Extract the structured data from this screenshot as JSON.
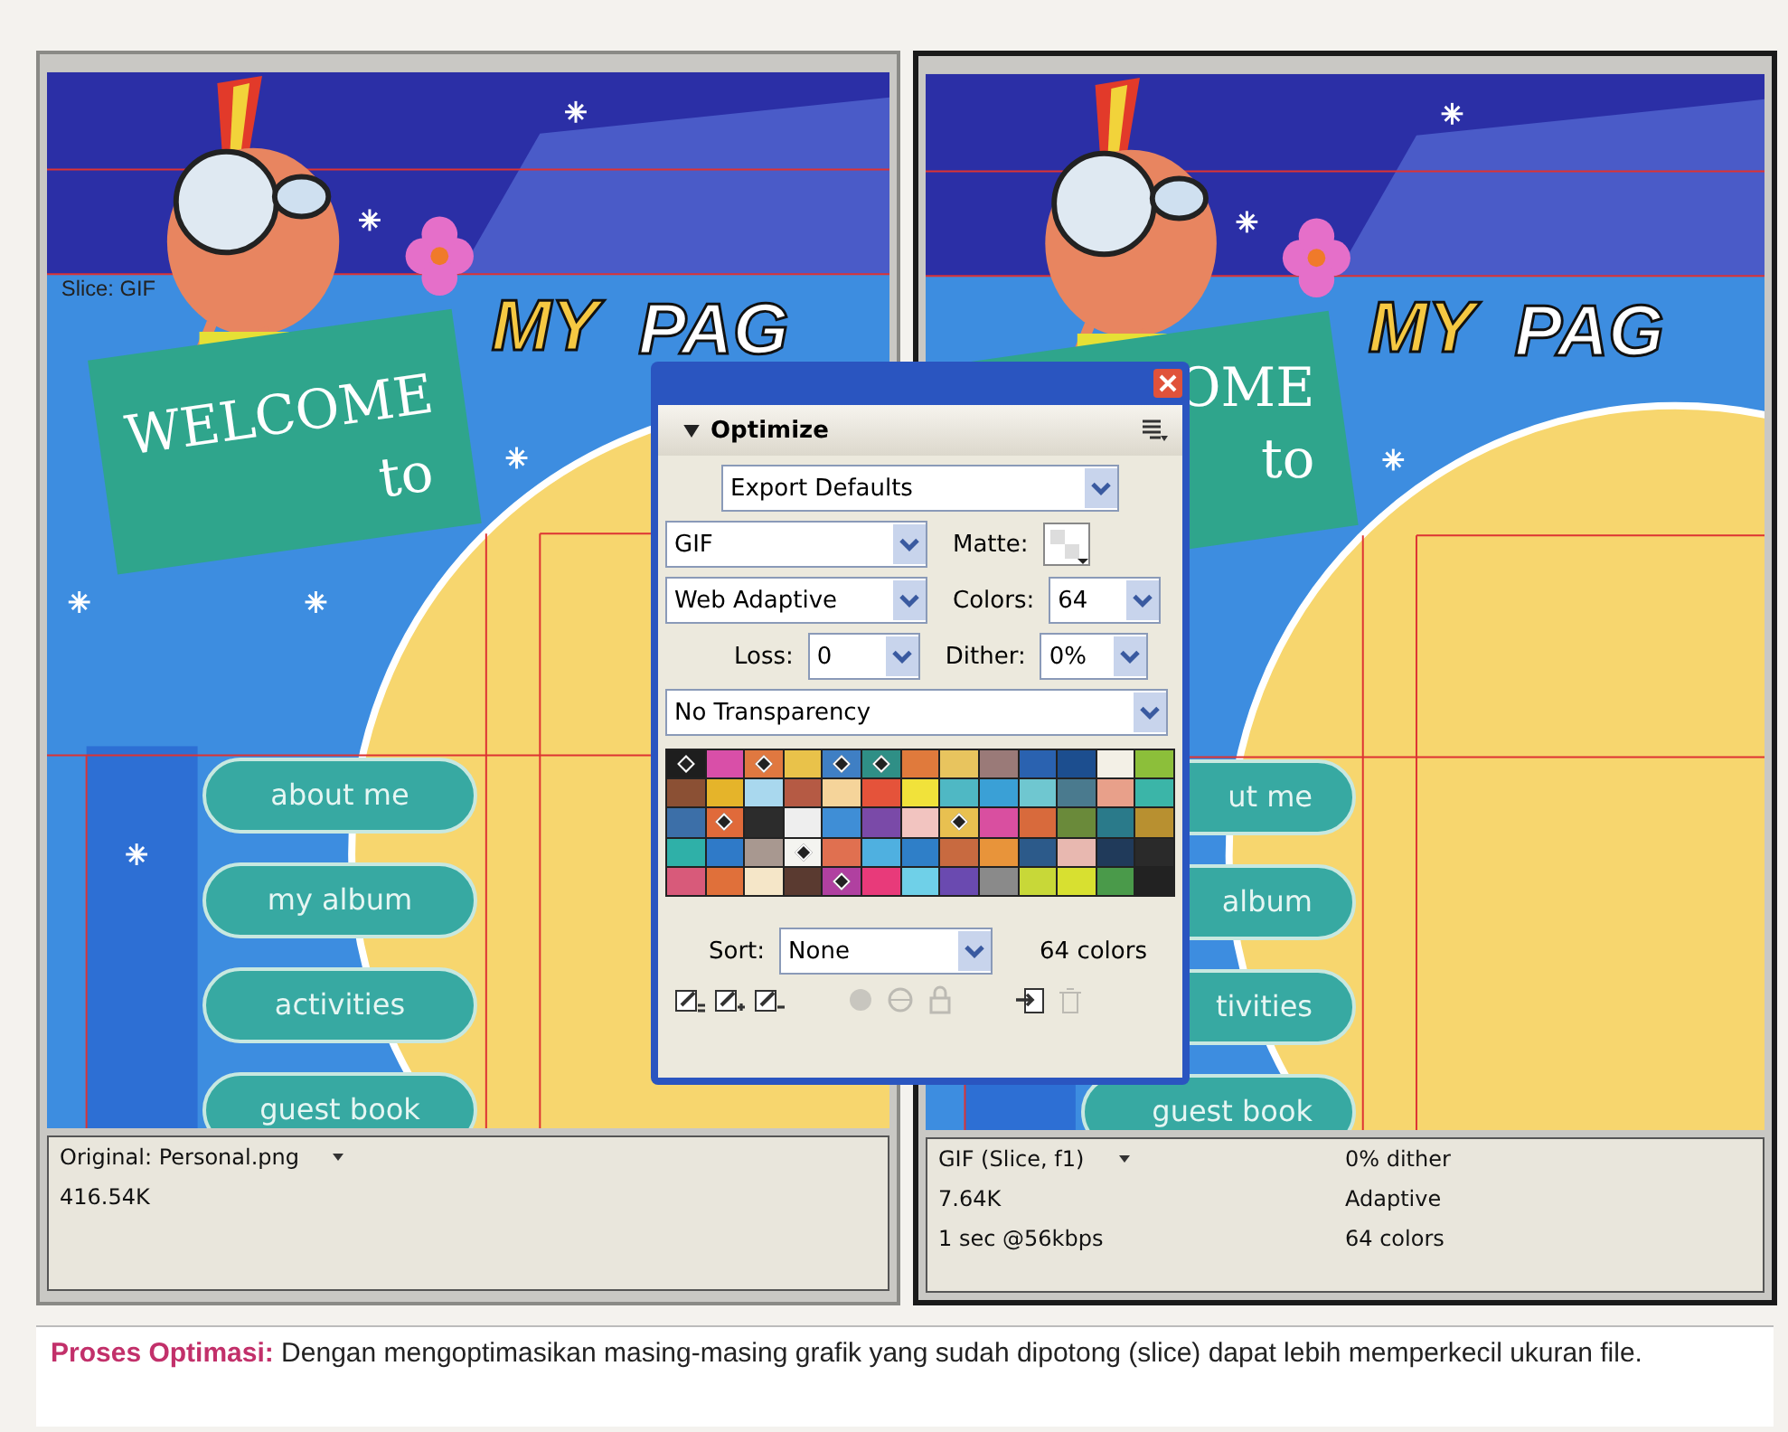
{
  "preview_panes": [
    {
      "selected": false,
      "canvas": {
        "slice_label": "Slice: GIF",
        "sign": [
          "WELCOME",
          "to"
        ],
        "title": [
          "MY",
          "PAG"
        ],
        "nav_buttons": [
          "about me",
          "my album",
          "activities",
          "guest book"
        ]
      },
      "info": {
        "format": "Original: Personal.png",
        "size": "416.54K"
      }
    },
    {
      "selected": true,
      "canvas": {
        "sign": [
          "OME",
          "to"
        ],
        "title": [
          "MY",
          "PAG"
        ],
        "nav_buttons": [
          "ut me",
          "album",
          "tivities",
          "guest book"
        ]
      },
      "info": {
        "format": "GIF (Slice, f1)",
        "size": "7.64K",
        "time": "1 sec @56kbps",
        "dither": "0% dither",
        "palette": "Adaptive",
        "colors": "64 colors"
      }
    }
  ],
  "optimize_panel": {
    "title": "Optimize",
    "preset": "Export Defaults",
    "format": "GIF",
    "matte_label": "Matte:",
    "palette": "Web Adaptive",
    "colors_label": "Colors:",
    "colors": "64",
    "loss_label": "Loss:",
    "loss": "0",
    "dither_label": "Dither:",
    "dither": "0%",
    "transparency": "No Transparency",
    "swatches": [
      {
        "color": "#1e1e1e",
        "marked": true
      },
      {
        "color": "#d94fa8",
        "marked": false
      },
      {
        "color": "#e07840",
        "marked": true
      },
      {
        "color": "#e9c24a",
        "marked": false
      },
      {
        "color": "#3f7fc4",
        "marked": true
      },
      {
        "color": "#2f8f86",
        "marked": true
      },
      {
        "color": "#e07a3c",
        "marked": false
      },
      {
        "color": "#e8c45e",
        "marked": false
      },
      {
        "color": "#9a7a78",
        "marked": false
      },
      {
        "color": "#2a62b0",
        "marked": false
      },
      {
        "color": "#1c4e8f",
        "marked": false
      },
      {
        "color": "#f3f0e6",
        "marked": false
      },
      {
        "color": "#8cbf3a",
        "marked": false
      },
      {
        "color": "#8b5034",
        "marked": false
      },
      {
        "color": "#e5b42a",
        "marked": false
      },
      {
        "color": "#a9d8ee",
        "marked": false
      },
      {
        "color": "#b55a44",
        "marked": false
      },
      {
        "color": "#f5d49a",
        "marked": false
      },
      {
        "color": "#e5533a",
        "marked": false
      },
      {
        "color": "#f1e23a",
        "marked": false
      },
      {
        "color": "#4fb8c4",
        "marked": false
      },
      {
        "color": "#3aa0d6",
        "marked": false
      },
      {
        "color": "#6fc7d0",
        "marked": false
      },
      {
        "color": "#4a7a8e",
        "marked": false
      },
      {
        "color": "#e8a08a",
        "marked": false
      },
      {
        "color": "#3bb5a8",
        "marked": false
      },
      {
        "color": "#3c6fa8",
        "marked": false
      },
      {
        "color": "#e06a3a",
        "marked": true
      },
      {
        "color": "#2c2c2c",
        "marked": false
      },
      {
        "color": "#eeeeee",
        "marked": false
      },
      {
        "color": "#3f8ed6",
        "marked": false
      },
      {
        "color": "#7a4aa8",
        "marked": false
      },
      {
        "color": "#f2c4c0",
        "marked": false
      },
      {
        "color": "#e8c050",
        "marked": true
      },
      {
        "color": "#d94fa0",
        "marked": false
      },
      {
        "color": "#d86a3c",
        "marked": false
      },
      {
        "color": "#6a8a3a",
        "marked": false
      },
      {
        "color": "#2a7a8a",
        "marked": false
      },
      {
        "color": "#b89030",
        "marked": false
      },
      {
        "color": "#2fb0a8",
        "marked": false
      },
      {
        "color": "#2f7ac8",
        "marked": false
      },
      {
        "color": "#a89890",
        "marked": false
      },
      {
        "color": "#f4f4f0",
        "marked": true
      },
      {
        "color": "#e07050",
        "marked": false
      },
      {
        "color": "#4fb0e0",
        "marked": false
      },
      {
        "color": "#2f7fc8",
        "marked": false
      },
      {
        "color": "#c86a40",
        "marked": false
      },
      {
        "color": "#e8943a",
        "marked": false
      },
      {
        "color": "#2c5a8a",
        "marked": false
      },
      {
        "color": "#e8b8b0",
        "marked": false
      },
      {
        "color": "#203a5a",
        "marked": false
      },
      {
        "color": "#2a2a2a",
        "marked": false
      },
      {
        "color": "#d85a7a",
        "marked": false
      },
      {
        "color": "#e0703a",
        "marked": false
      },
      {
        "color": "#f5e6c8",
        "marked": false
      },
      {
        "color": "#5a3a30",
        "marked": false
      },
      {
        "color": "#b040a0",
        "marked": true
      },
      {
        "color": "#e83a7a",
        "marked": false
      },
      {
        "color": "#6fd0e8",
        "marked": false
      },
      {
        "color": "#6a4ab0",
        "marked": false
      },
      {
        "color": "#8a8a8a",
        "marked": false
      },
      {
        "color": "#c8d838",
        "marked": false
      },
      {
        "color": "#d8e030",
        "marked": false
      },
      {
        "color": "#4a9a4a",
        "marked": false
      }
    ],
    "sort_label": "Sort:",
    "sort": "None",
    "color_count": "64 colors",
    "tools": [
      {
        "kind": "edit",
        "disabled": false
      },
      {
        "kind": "add",
        "disabled": false
      },
      {
        "kind": "remove",
        "disabled": false
      },
      {
        "kind": "snap",
        "disabled": true
      },
      {
        "kind": "transparent",
        "disabled": true
      },
      {
        "kind": "lock",
        "disabled": true
      },
      {
        "kind": "import",
        "disabled": false
      },
      {
        "kind": "delete",
        "disabled": true
      }
    ]
  },
  "caption": "**Proses Optimasi:** Dengan mengoptimasikan masing-masing grafik yang sudah dipotong (slice) dapat lebih memperkecil ukuran file."
}
